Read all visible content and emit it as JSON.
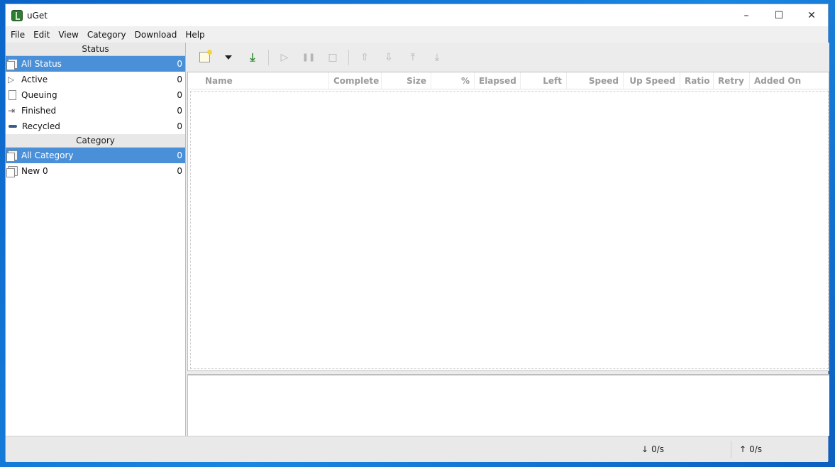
{
  "window": {
    "title": "uGet"
  },
  "menu": [
    "File",
    "Edit",
    "View",
    "Category",
    "Download",
    "Help"
  ],
  "status_section": {
    "header": "Status",
    "items": [
      {
        "label": "All Status",
        "count": "0",
        "icon": "all-status-icon"
      },
      {
        "label": "Active",
        "count": "0",
        "icon": "active-icon"
      },
      {
        "label": "Queuing",
        "count": "0",
        "icon": "queuing-icon"
      },
      {
        "label": "Finished",
        "count": "0",
        "icon": "finished-icon"
      },
      {
        "label": "Recycled",
        "count": "0",
        "icon": "recycled-icon"
      }
    ]
  },
  "category_section": {
    "header": "Category",
    "items": [
      {
        "label": "All Category",
        "count": "0",
        "icon": "all-category-icon"
      },
      {
        "label": "New 0",
        "count": "0",
        "icon": "category-icon"
      }
    ]
  },
  "columns": [
    "Name",
    "Complete",
    "Size",
    "%",
    "Elapsed",
    "Left",
    "Speed",
    "Up Speed",
    "Ratio",
    "Retry",
    "Added On"
  ],
  "statusbar": {
    "down_arrow": "↓",
    "down_speed": "0/s",
    "up_arrow": "↑",
    "up_speed": "0/s"
  },
  "colors": {
    "selection": "#4a90d9",
    "accent_download": "#2e8b2e"
  }
}
